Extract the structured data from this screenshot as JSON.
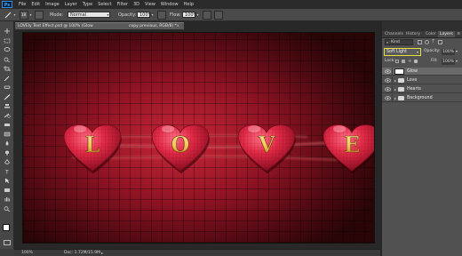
{
  "app": {
    "logo": "Ps",
    "menu": [
      "File",
      "Edit",
      "Image",
      "Layer",
      "Type",
      "Select",
      "Filter",
      "3D",
      "View",
      "Window",
      "Help"
    ]
  },
  "options": {
    "brush_size": "18",
    "mode_label": "Mode:",
    "mode_value": "Normal",
    "opacity_label": "Opacity:",
    "opacity_value": "100%",
    "flow_label": "Flow:",
    "flow_value": "100%"
  },
  "document": {
    "tab_title": "LOVEly Text Effect.psd @ 100% (Glow",
    "tab_subtitle": "copy previous, RGB/8) *",
    "close_glyph": "x"
  },
  "artwork": {
    "letters": [
      "L",
      "O",
      "V",
      "E"
    ],
    "heart_color": "#e02a46",
    "letter_color": "#f2c75a",
    "background_color": "#8e1323"
  },
  "status": {
    "zoom": "100%",
    "doc_info": "Doc: 1.72M/15.9M"
  },
  "panels": {
    "tabs": [
      "Channels",
      "History",
      "Color",
      "Layers"
    ],
    "active_tab": "Layers",
    "kind_label": "Kind",
    "blend_mode": "Soft Light",
    "opacity_label": "Opacity:",
    "opacity_value": "100%",
    "lock_label": "Lock:",
    "fill_label": "Fill:",
    "fill_value": "100%",
    "layers": [
      {
        "name": "Glow",
        "type": "layer",
        "selected": true
      },
      {
        "name": "Love",
        "type": "group",
        "selected": false
      },
      {
        "name": "Hearts",
        "type": "group",
        "selected": false
      },
      {
        "name": "Background",
        "type": "group",
        "selected": false
      }
    ]
  },
  "colors": {
    "highlight": "#e0e040",
    "accent": "#31a8ff"
  }
}
